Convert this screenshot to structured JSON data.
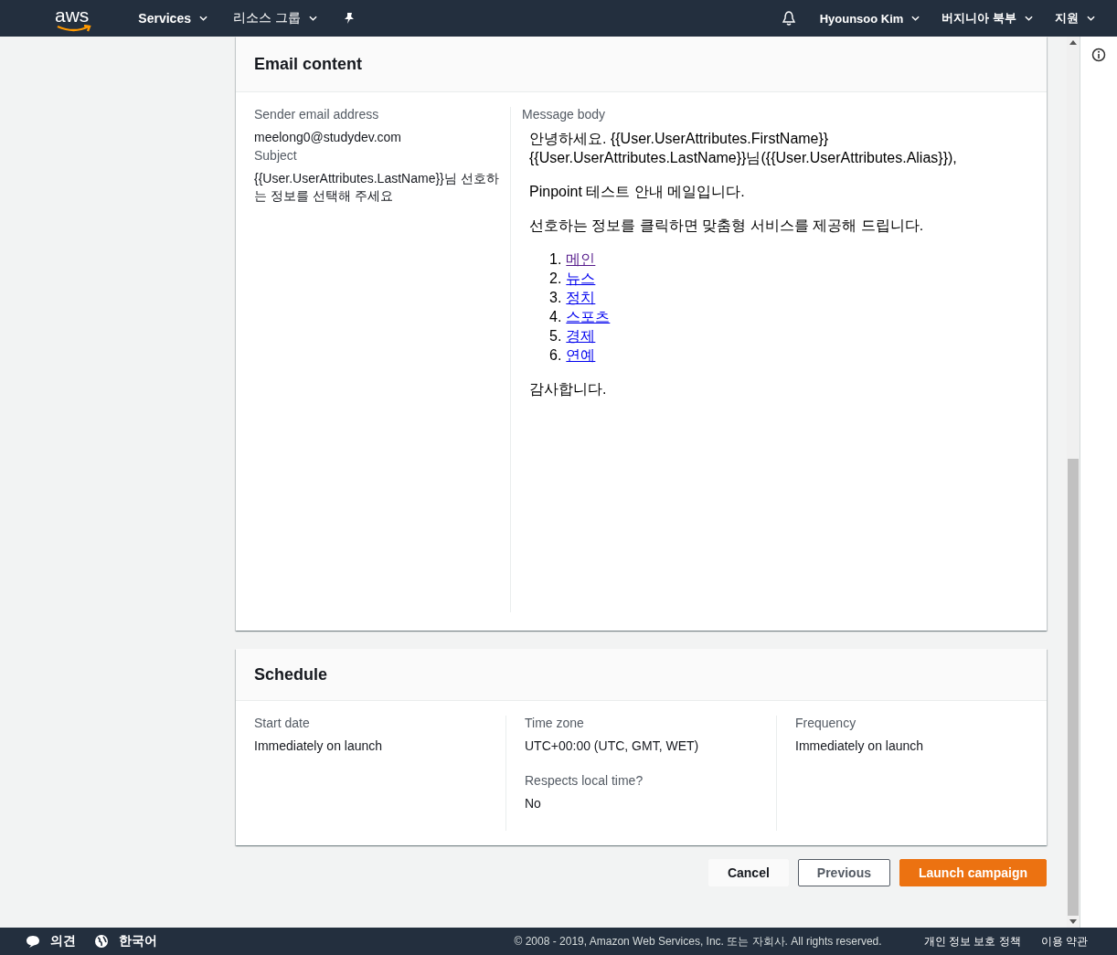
{
  "top_nav": {
    "logo": "aws",
    "menus": [
      {
        "label": "Services",
        "kind": "dropdown"
      },
      {
        "label": "리소스 그룹",
        "kind": "dropdown"
      }
    ],
    "right": [
      {
        "label": "Hyounsoo Kim"
      },
      {
        "label": "버지니아 북부"
      },
      {
        "label": "지원"
      }
    ]
  },
  "email_content": {
    "title": "Email content",
    "fields": [
      {
        "label": "Sender email address",
        "value": "meelong0@studydev.com"
      },
      {
        "label": "Subject",
        "value": "{{User.UserAttributes.LastName}}님 선호하는 정보를 선택해 주세요"
      }
    ],
    "message_body": {
      "label": "Message body",
      "greeting": "안녕하세요. {{User.UserAttributes.FirstName}} {{User.UserAttributes.LastName}}님({{User.UserAttributes.Alias}}),",
      "paragraphs": [
        "Pinpoint 테스트 안내 메일입니다.",
        "선호하는 정보를 클릭하면 맞춤형 서비스를 제공해 드립니다."
      ],
      "links": [
        {
          "number": "1.",
          "label": "메인",
          "visited": true
        },
        {
          "number": "2.",
          "label": "뉴스",
          "visited": false
        },
        {
          "number": "3.",
          "label": "정치",
          "visited": false
        },
        {
          "number": "4.",
          "label": "스포츠",
          "visited": false
        },
        {
          "number": "5.",
          "label": "경제",
          "visited": false
        },
        {
          "number": "6.",
          "label": "연예",
          "visited": false
        }
      ],
      "closing": "감사합니다."
    }
  },
  "schedule": {
    "title": "Schedule",
    "columns": [
      [
        {
          "label": "Start date",
          "value": "Immediately on launch"
        }
      ],
      [
        {
          "label": "Time zone",
          "value": "UTC+00:00 (UTC, GMT, WET)"
        },
        {
          "label": "Respects local time?",
          "value": "No"
        }
      ],
      [
        {
          "label": "Frequency",
          "value": "Immediately on launch"
        }
      ]
    ]
  },
  "buttons": [
    {
      "label": "Cancel",
      "kind": "link"
    },
    {
      "label": "Previous",
      "kind": "secondary"
    },
    {
      "label": "Launch campaign",
      "kind": "primary"
    }
  ],
  "footer": {
    "left": [
      {
        "label": "의견",
        "kind": "feedback"
      },
      {
        "label": "한국어",
        "kind": "language"
      }
    ],
    "copyright": "© 2008 - 2019, Amazon Web Services, Inc. 또는 자회사. All rights reserved.",
    "links": [
      "개인 정보 보호 정책",
      "이용 약관"
    ]
  }
}
